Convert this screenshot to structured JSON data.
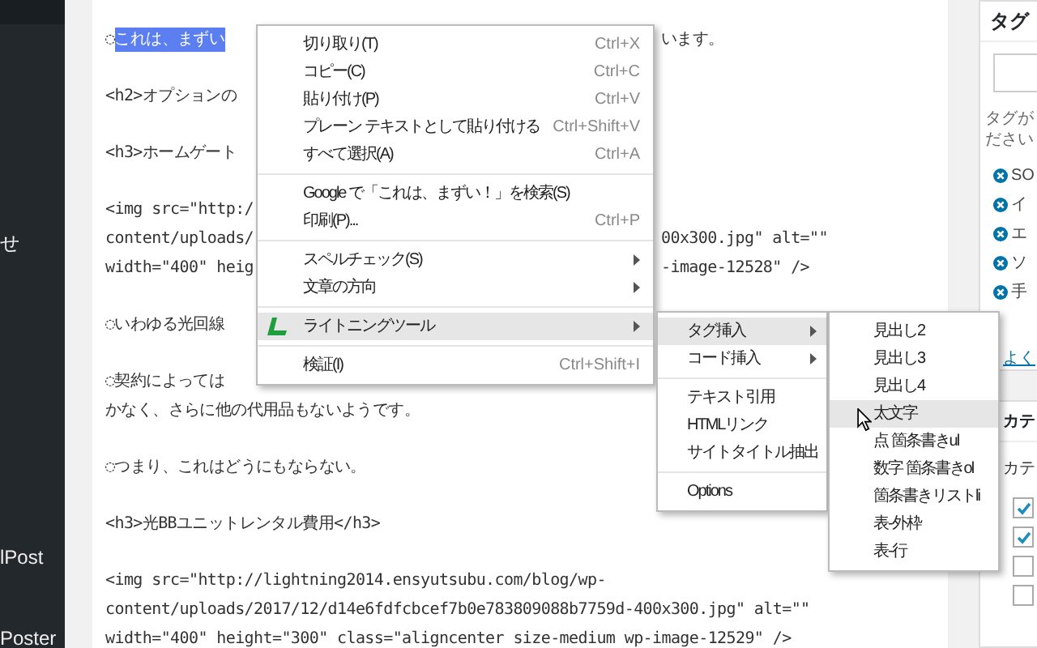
{
  "admin_menu": {
    "items": [
      {
        "label": "せ"
      },
      {
        "label": "lPost"
      },
      {
        "label": "Poster"
      }
    ]
  },
  "editor": {
    "paragraphs": [
      {
        "lines": [
          {
            "parts": [
              {
                "text": "◌",
                "selected": false
              },
              {
                "text": "これは、まずい",
                "selected": true
              }
            ],
            "tail": "います。"
          }
        ]
      },
      {
        "lines": [
          {
            "parts": [
              {
                "text": "<h2>オプションの",
                "selected": false
              }
            ]
          }
        ]
      },
      {
        "lines": [
          {
            "parts": [
              {
                "text": "<h3>ホームゲート",
                "selected": false
              }
            ]
          }
        ]
      },
      {
        "lines": [
          {
            "parts": [
              {
                "text": "<img src=\"http:/",
                "selected": false
              }
            ]
          },
          {
            "parts": [
              {
                "text": "content/uploads/",
                "selected": false
              }
            ],
            "tail": "00x300.jpg\" alt=\"\""
          },
          {
            "parts": [
              {
                "text": "width=\"400\" heig",
                "selected": false
              }
            ],
            "tail": "-image-12528\" />"
          }
        ]
      },
      {
        "lines": [
          {
            "parts": [
              {
                "text": "◌いわゆる光回線",
                "selected": false
              }
            ]
          }
        ]
      },
      {
        "lines": [
          {
            "parts": [
              {
                "text": "◌契約によっては",
                "selected": false
              }
            ]
          },
          {
            "parts": [
              {
                "text": "かなく、さらに他の代用品もないようです。",
                "selected": false
              }
            ]
          }
        ]
      },
      {
        "lines": [
          {
            "parts": [
              {
                "text": "◌つまり、これはどうにもならない。",
                "selected": false
              }
            ]
          }
        ]
      },
      {
        "lines": [
          {
            "parts": [
              {
                "text": "<h3>光BBユニットレンタル費用</h3>",
                "selected": false
              }
            ]
          }
        ]
      },
      {
        "lines": [
          {
            "parts": [
              {
                "text": "<img src=\"http://lightning2014.ensyutsubu.com/blog/wp-",
                "selected": false
              }
            ]
          },
          {
            "parts": [
              {
                "text": "content/uploads/2017/12/d14e6fdfcbcef7b0e783809088b7759d-400x300.jpg\" alt=\"\"",
                "selected": false
              }
            ]
          },
          {
            "parts": [
              {
                "text": "width=\"400\" height=\"300\" class=\"aligncenter size-medium wp-image-12529\" />",
                "selected": false
              }
            ]
          }
        ]
      }
    ]
  },
  "context_menu": {
    "items": [
      {
        "kind": "item",
        "label": "切り取り(T)",
        "shortcut": "Ctrl+X",
        "submenu": false,
        "highlighted": false
      },
      {
        "kind": "item",
        "label": "コピー(C)",
        "shortcut": "Ctrl+C",
        "submenu": false,
        "highlighted": false
      },
      {
        "kind": "item",
        "label": "貼り付け(P)",
        "shortcut": "Ctrl+V",
        "submenu": false,
        "highlighted": false
      },
      {
        "kind": "item",
        "label": "プレーン テキストとして貼り付ける",
        "shortcut": "Ctrl+Shift+V",
        "submenu": false,
        "highlighted": false
      },
      {
        "kind": "item",
        "label": "すべて選択(A)",
        "shortcut": "Ctrl+A",
        "submenu": false,
        "highlighted": false
      },
      {
        "kind": "separator"
      },
      {
        "kind": "item",
        "label": "Google で「これは、まずい！」を検索(S)",
        "submenu": false,
        "highlighted": false
      },
      {
        "kind": "item",
        "label": "印刷(P)...",
        "shortcut": "Ctrl+P",
        "submenu": false,
        "highlighted": false
      },
      {
        "kind": "separator"
      },
      {
        "kind": "item",
        "label": "スペルチェック(S)",
        "submenu": true,
        "highlighted": false
      },
      {
        "kind": "item",
        "label": "文章の方向",
        "submenu": true,
        "highlighted": false
      },
      {
        "kind": "separator"
      },
      {
        "kind": "extension",
        "label": "ライトニングツール",
        "submenu": true,
        "highlighted": true
      },
      {
        "kind": "separator"
      },
      {
        "kind": "item",
        "label": "検証(I)",
        "shortcut": "Ctrl+Shift+I",
        "submenu": false,
        "highlighted": false
      }
    ]
  },
  "tool_submenu": {
    "items": [
      {
        "kind": "item",
        "label": "タグ挿入",
        "submenu": true,
        "highlighted": true
      },
      {
        "kind": "item",
        "label": "コード挿入",
        "submenu": true,
        "highlighted": false
      },
      {
        "kind": "separator"
      },
      {
        "kind": "item",
        "label": "テキスト引用",
        "submenu": false,
        "highlighted": false
      },
      {
        "kind": "item",
        "label": "HTMLリンク",
        "submenu": false,
        "highlighted": false
      },
      {
        "kind": "item",
        "label": "サイトタイトル抽出",
        "submenu": false,
        "highlighted": false
      },
      {
        "kind": "separator"
      },
      {
        "kind": "item",
        "label": "Options",
        "submenu": false,
        "highlighted": false
      }
    ]
  },
  "tag_submenu": {
    "items": [
      {
        "label": "見出し2",
        "highlighted": false
      },
      {
        "label": "見出し3",
        "highlighted": false
      },
      {
        "label": "見出し4",
        "highlighted": false
      },
      {
        "label": "太文字",
        "highlighted": true
      },
      {
        "label": "点 箇条書きul",
        "highlighted": false
      },
      {
        "label": "数字 箇条書きol",
        "highlighted": false
      },
      {
        "label": "箇条書きリストli",
        "highlighted": false
      },
      {
        "label": "表-外枠",
        "highlighted": false
      },
      {
        "label": "表-行",
        "highlighted": false
      }
    ]
  },
  "tags_panel": {
    "title": "タグ",
    "help": [
      "タグが",
      "ださい"
    ],
    "tags": [
      "SO",
      "イ",
      "エ",
      "ソ",
      "手"
    ],
    "link": "よく"
  },
  "categories_panel": {
    "title": "カテ",
    "tab": "カテ",
    "checkboxes": [
      {
        "checked": true
      },
      {
        "checked": true
      },
      {
        "checked": false
      },
      {
        "checked": false
      }
    ]
  }
}
